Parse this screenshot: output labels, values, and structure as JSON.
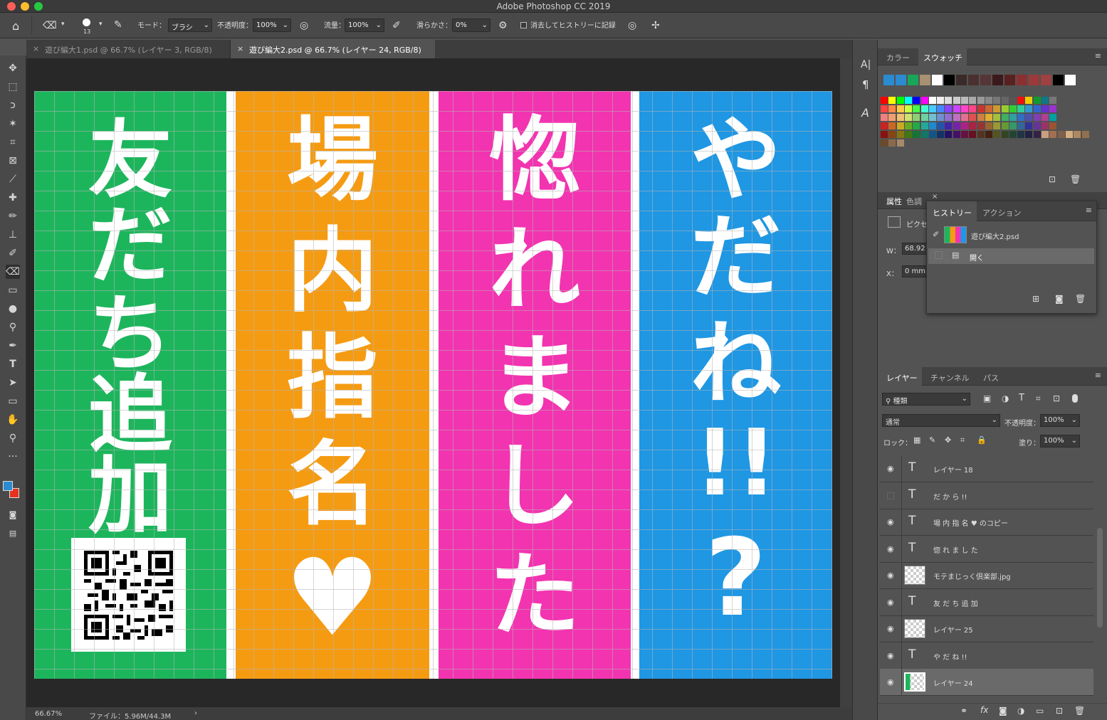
{
  "window": {
    "title": "Adobe Photoshop CC 2019"
  },
  "options": {
    "brush_size": "13",
    "mode_label": "モード：",
    "mode_value": "ブラシ",
    "opacity_label": "不透明度：",
    "opacity_value": "100%",
    "flow_label": "流量：",
    "flow_value": "100%",
    "smooth_label": "滑らかさ：",
    "smooth_value": "0%",
    "erase_history_label": "消去してヒストリーに記録"
  },
  "tabs": [
    {
      "label": "遊び編大1.psd @ 66.7% (レイヤー 3, RGB/8)"
    },
    {
      "label": "遊び編大2.psd @ 66.7% (レイヤー 24, RGB/8)"
    }
  ],
  "canvas": {
    "bands": [
      {
        "color": "#1db55c",
        "lines": [
          "友",
          "だ",
          "ち",
          "追",
          "加"
        ]
      },
      {
        "color": "#f59b12",
        "lines": [
          "場",
          "内",
          "指",
          "名",
          "♥"
        ]
      },
      {
        "color": "#f234b0",
        "lines": [
          "惚",
          "れ",
          "ま",
          "し",
          "た"
        ]
      },
      {
        "color": "#1f97e3",
        "lines": [
          "や",
          "だ",
          "ね",
          "!!",
          "?"
        ]
      }
    ]
  },
  "status": {
    "zoom": "66.67%",
    "file": "ファイル：5.96M/44.3M"
  },
  "swatch_panel": {
    "tabs": [
      "カラー",
      "スウォッチ"
    ],
    "recent": [
      "#2b8bd0",
      "#2b8bd0",
      "#1aa65a",
      "#a89070",
      "#ffffff",
      "#000000",
      "#3a2a2a",
      "#4a3030",
      "#553535",
      "#3a1a1a",
      "#5a2020",
      "#8b3030",
      "#9a3a3a",
      "#a04040",
      "#000000",
      "#ffffff"
    ],
    "grid_rows": [
      [
        "#ff0000",
        "#ffff00",
        "#00ff00",
        "#00ffff",
        "#0000ff",
        "#ff00ff",
        "#ffffff",
        "#eeeeee",
        "#dddddd",
        "#cccccc",
        "#bbbbbb",
        "#aaaaaa",
        "#999999",
        "#888888",
        "#777777",
        "#666666",
        "#555555",
        "#ee1111",
        "#eecc00",
        "#119933",
        "#117788",
        "#777777"
      ],
      [
        "#ff4444",
        "#ff8844",
        "#ffcc44",
        "#ccff44",
        "#44ff44",
        "#44ffcc",
        "#44ccff",
        "#4488ff",
        "#8844ff",
        "#cc44ff",
        "#ff44cc",
        "#ff4488",
        "#cc3333",
        "#cc6633",
        "#cc9933",
        "#99cc33",
        "#33cc33",
        "#33cc99",
        "#3399cc",
        "#3366cc",
        "#6633cc",
        "#9933cc"
      ],
      [
        "#f08080",
        "#f0a070",
        "#f0c070",
        "#d0e070",
        "#90d070",
        "#70d0a0",
        "#70c0d0",
        "#7090d0",
        "#9070d0",
        "#c070c0",
        "#e07090",
        "#e05050",
        "#d08040",
        "#e0b030",
        "#a0c040",
        "#40b060",
        "#30a0a0",
        "#3070c0",
        "#5050b0",
        "#8040b0",
        "#b04090",
        "#00a0a0"
      ],
      [
        "#cc2222",
        "#cc6622",
        "#ccaa22",
        "#66aa22",
        "#22aa44",
        "#22aa99",
        "#2288cc",
        "#2255aa",
        "#4422aa",
        "#7722aa",
        "#aa2288",
        "#aa2244",
        "#993333",
        "#996633",
        "#999933",
        "#669933",
        "#339966",
        "#336699",
        "#333399",
        "#663399",
        "#993366",
        "#995533"
      ],
      [
        "#881111",
        "#884411",
        "#887711",
        "#447711",
        "#117733",
        "#117766",
        "#115588",
        "#113366",
        "#221166",
        "#441166",
        "#661144",
        "#661122",
        "#553322",
        "#442211",
        "#555522",
        "#334422",
        "#224433",
        "#223344",
        "#222244",
        "#332244",
        "#c8a080",
        "#a07050",
        "#80604a",
        "#d4b080",
        "#b08860",
        "#907050"
      ],
      [
        "#6b4a2a",
        "#8b6a4a",
        "#a88a6a"
      ]
    ]
  },
  "properties_panel": {
    "tabs": [
      "属性",
      "色調"
    ],
    "kind": "ピクセル",
    "w_label": "W：",
    "w_value": "68.92",
    "x_label": "X：",
    "x_value": "0 mm"
  },
  "history_panel": {
    "tabs": [
      "ヒストリー",
      "アクション"
    ],
    "snapshot": "遊び編大2.psd",
    "items": [
      "開く"
    ]
  },
  "layers_panel": {
    "tabs": [
      "レイヤー",
      "チャンネル",
      "パス"
    ],
    "filter": "種類",
    "blend": "通常",
    "opacity_label": "不透明度：",
    "opacity_value": "100%",
    "lock_label": "ロック：",
    "fill_label": "塗り：",
    "fill_value": "100%",
    "layers": [
      {
        "name": "レイヤー 18",
        "type": "text",
        "visible": true
      },
      {
        "name": "だ か ら !!",
        "type": "text",
        "visible": false
      },
      {
        "name": "場 内 指 名 ♥ のコピー",
        "type": "text",
        "visible": true
      },
      {
        "name": "惚 れ ま し た",
        "type": "text",
        "visible": true
      },
      {
        "name": "モテまじっく倶楽部.jpg",
        "type": "image",
        "visible": true
      },
      {
        "name": "友 だ ち 追 加",
        "type": "text",
        "visible": true
      },
      {
        "name": "レイヤー 25",
        "type": "pixel",
        "visible": true
      },
      {
        "name": "や だ ね !!",
        "type": "text",
        "visible": true
      },
      {
        "name": "レイヤー 24",
        "type": "pixel",
        "visible": true,
        "selected": true
      }
    ]
  },
  "colors": {
    "fg": "#2b8bd0",
    "bg": "#e8321e"
  }
}
